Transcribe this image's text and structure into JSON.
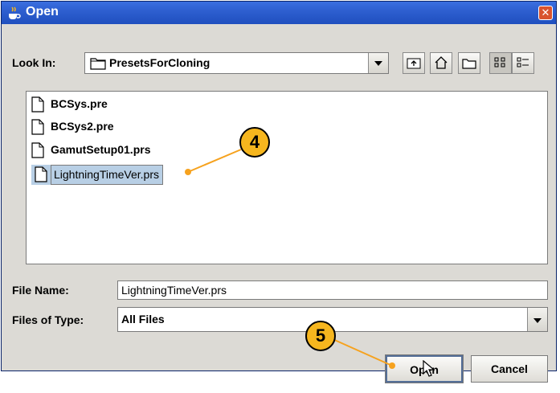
{
  "window": {
    "title": "Open"
  },
  "lookin": {
    "label": "Look In:",
    "value": "PresetsForCloning"
  },
  "files": [
    {
      "name": "BCSys.pre",
      "selected": false
    },
    {
      "name": "BCSys2.pre",
      "selected": false
    },
    {
      "name": "GamutSetup01.prs",
      "selected": false
    },
    {
      "name": "LightningTimeVer.prs",
      "selected": true
    }
  ],
  "filename": {
    "label": "File Name:",
    "value": "LightningTimeVer.prs"
  },
  "filetype": {
    "label": "Files of Type:",
    "value": "All Files"
  },
  "buttons": {
    "open": "Open",
    "cancel": "Cancel"
  },
  "callouts": {
    "first": "4",
    "second": "5"
  },
  "colors": {
    "titlebar": "#2e5fd0",
    "callout": "#f6b61e",
    "selection": "#b8cfe5"
  }
}
